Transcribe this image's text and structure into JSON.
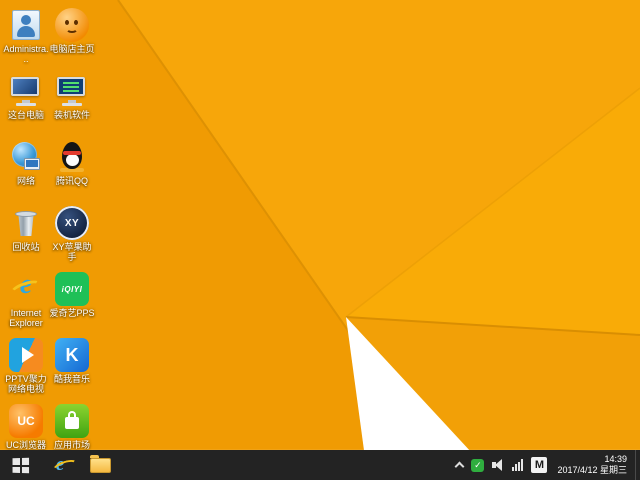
{
  "desktop": {
    "icons": [
      {
        "name": "administrator",
        "label": "Administra..."
      },
      {
        "name": "diannaodian-homepage",
        "label": "电脑店主页"
      },
      {
        "name": "this-pc",
        "label": "这台电脑"
      },
      {
        "name": "setup-software",
        "label": "装机软件"
      },
      {
        "name": "network",
        "label": "网络"
      },
      {
        "name": "tencent-qq",
        "label": "腾讯QQ"
      },
      {
        "name": "recycle-bin",
        "label": "回收站"
      },
      {
        "name": "xy-apple-assistant",
        "label": "XY苹果助手",
        "glyph": "XY"
      },
      {
        "name": "internet-explorer",
        "label": "Internet Explorer",
        "glyph": "e"
      },
      {
        "name": "iqiyi-pps",
        "label": "爱奇艺PPS",
        "glyph": "iQIYI"
      },
      {
        "name": "pptv",
        "label": "PPTV聚力 网络电视"
      },
      {
        "name": "kuwo-music",
        "label": "酷我音乐",
        "glyph": "K"
      },
      {
        "name": "uc-browser",
        "label": "UC浏览器",
        "glyph": "UC"
      },
      {
        "name": "app-market",
        "label": "应用市场"
      }
    ]
  },
  "taskbar": {
    "ie_glyph": "e",
    "tray": {
      "ime": "M",
      "time": "14:39",
      "date": "2017/4/12 星期三"
    }
  },
  "colors": {
    "wallpaper_base": "#F7A60A",
    "wallpaper_shadow": "#F09B03",
    "wallpaper_bright": "#F9AB07",
    "wallpaper_white": "#FFFFFF",
    "taskbar_background": "#232323",
    "icon_label_text": "#FFFFFF"
  }
}
